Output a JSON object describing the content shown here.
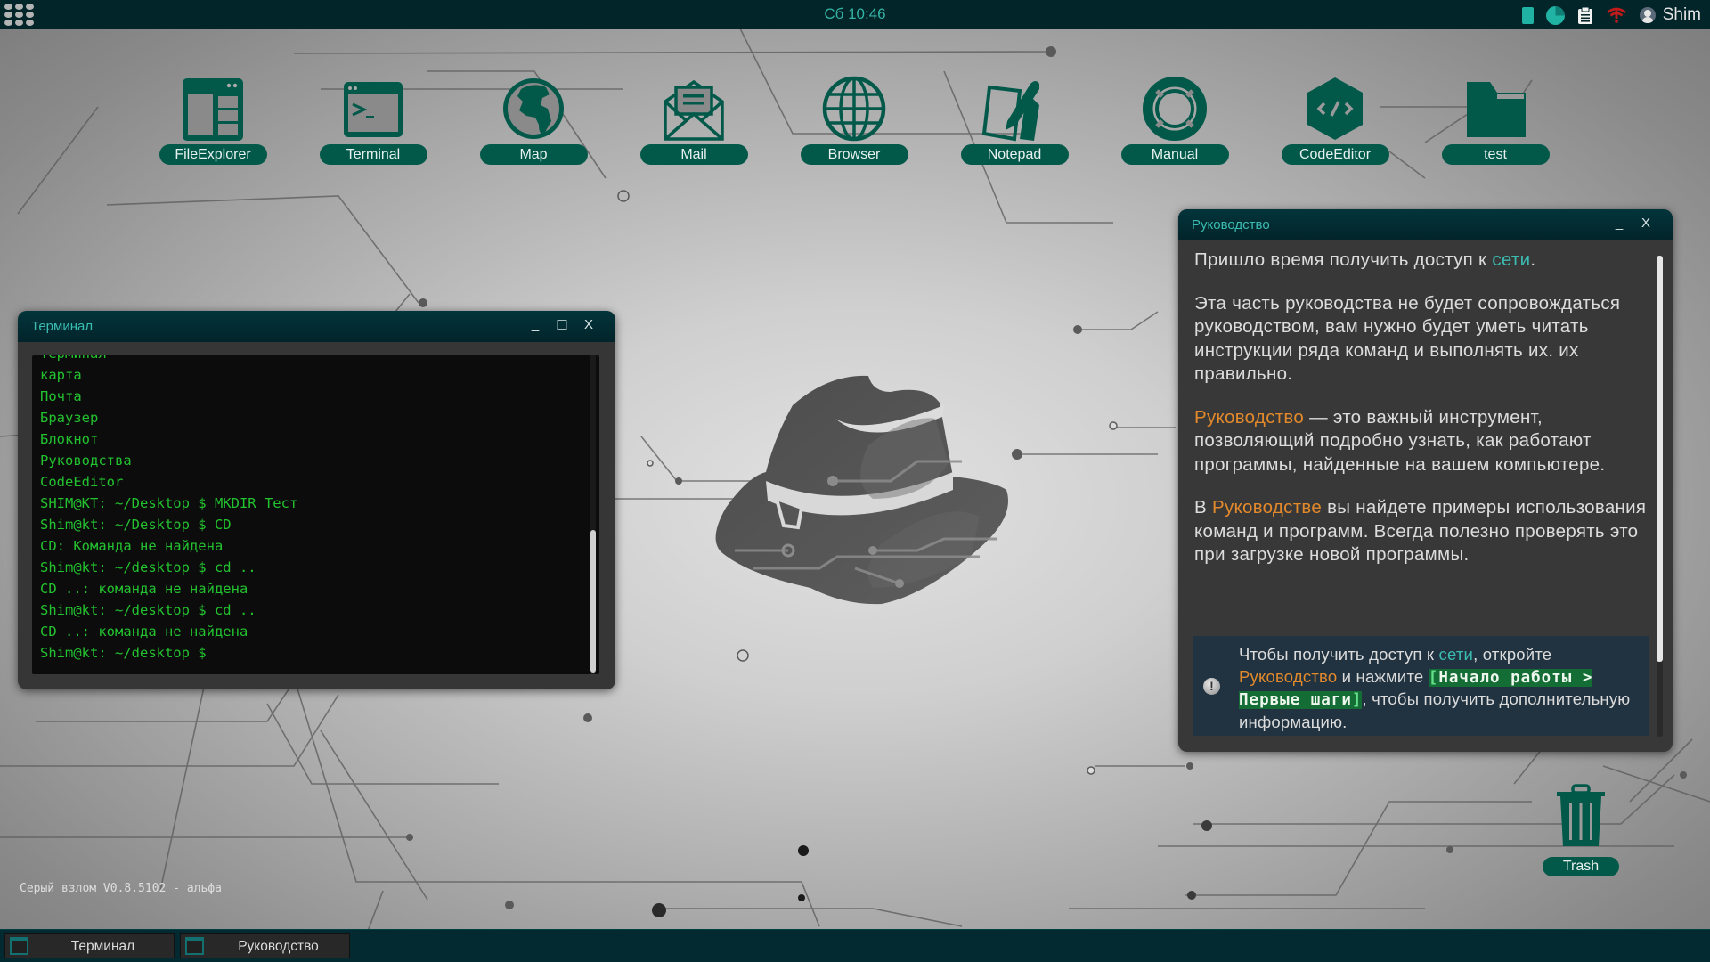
{
  "topbar": {
    "clock": "Сб 10:46",
    "user_name": "Shim",
    "tray_icons": [
      "battery-icon",
      "cpu-pie-icon",
      "clipboard-icon",
      "network-disconnected-icon",
      "user-avatar-icon"
    ]
  },
  "desktop_icons": [
    {
      "label": "FileExplorer",
      "icon": "file-explorer-icon"
    },
    {
      "label": "Terminal",
      "icon": "terminal-icon"
    },
    {
      "label": "Map",
      "icon": "globe-map-icon"
    },
    {
      "label": "Mail",
      "icon": "mail-icon"
    },
    {
      "label": "Browser",
      "icon": "browser-globe-icon"
    },
    {
      "label": "Notepad",
      "icon": "notepad-icon"
    },
    {
      "label": "Manual",
      "icon": "lifebuoy-icon"
    },
    {
      "label": "CodeEditor",
      "icon": "code-editor-icon"
    },
    {
      "label": "test",
      "icon": "folder-icon"
    }
  ],
  "terminal": {
    "title": "Терминал",
    "lines": [
      "Терминал",
      "карта",
      "Почта",
      "Браузер",
      "Блокнот",
      "Руководства",
      "CodeEditor",
      "SHIM@KT: ~/Desktop $ MKDIR Тест",
      "Shim@kt: ~/Desktop $ CD",
      "CD: Команда не найдена",
      "Shim@kt: ~/desktop $ cd ..",
      "CD ..: команда не найдена",
      "Shim@kt: ~/desktop $ cd ..",
      "CD ..: команда не найдена",
      "Shim@kt: ~/desktop $"
    ],
    "buttons": {
      "minimize": "_",
      "maximize": "☐",
      "close": "X"
    }
  },
  "guide": {
    "title": "Руководство",
    "buttons": {
      "minimize": "_",
      "close": "X"
    },
    "p1": {
      "a": "Пришло время получить доступ к ",
      "link": "сети",
      "b": "."
    },
    "p2": "Эта часть руководства не будет сопровождаться руководством, вам нужно будет уметь читать инструкции ряда команд и выполнять их. их правильно.",
    "p3": {
      "link": "Руководство",
      "b": " — это важный инструмент, позволяющий подробно узнать, как работают программы, найденные на вашем компьютере."
    },
    "p4": {
      "a": "В ",
      "link": "Руководстве",
      "b": " вы найдете примеры использования команд и программ. Всегда полезно проверять это при загрузке новой программы."
    },
    "tip": {
      "a": "Чтобы получить доступ к ",
      "link_net": "сети",
      "b": ", откройте ",
      "link_guide": "Руководство",
      "c": " и нажмите ",
      "kbd_open": "[",
      "kbd_text": "Начало работы > Первые шаги",
      "kbd_close": "]",
      "d": ", чтобы получить дополнительную информацию."
    }
  },
  "trash": {
    "label": "Trash"
  },
  "version": "Серый взлом V0.8.5102 - альфа",
  "taskbar": {
    "items": [
      {
        "label": "Терминал",
        "icon": "terminal-icon"
      },
      {
        "label": "Руководство",
        "icon": "window-icon"
      }
    ]
  },
  "colors": {
    "accent_cyan": "#3bbcb0",
    "accent_orange": "#e2892c",
    "icon_green": "#02594a",
    "terminal_text": "#23c22f",
    "bar_bg": "#02252a"
  }
}
